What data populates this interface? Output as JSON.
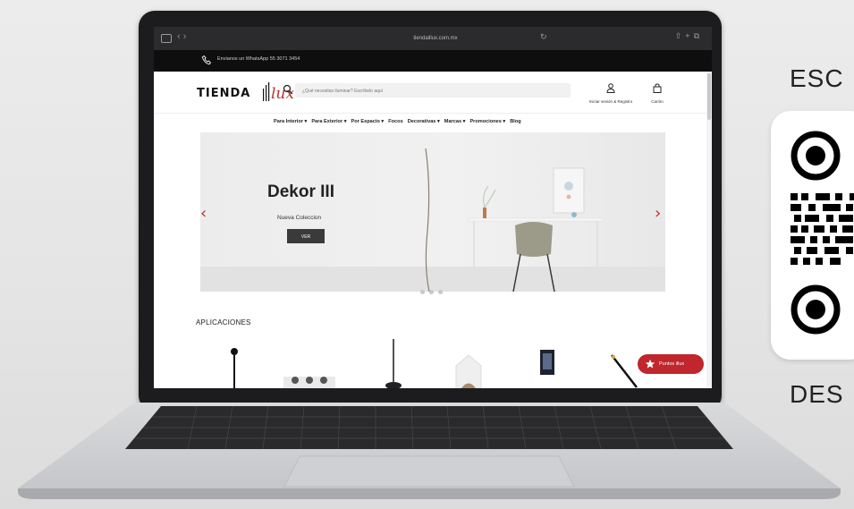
{
  "browser": {
    "url": "tiendaillux.com.mx",
    "nav_glyph": "‹ ›",
    "icons": [
      "sidebar-icon",
      "back-icon",
      "forward-icon",
      "reload-icon",
      "share-icon",
      "new-tab-icon",
      "tabs-icon"
    ]
  },
  "top_bar": {
    "whatsapp_text": "Envianos un WhatsApp 55 3071 3454"
  },
  "header": {
    "logo_text": "TIENDA",
    "logo_mark": "lux",
    "search_placeholder": "¿Qué necesitas iluminar? Escríbelo aquí",
    "account_label": "Iniciar sesión & Registro",
    "cart_label": "Carrito"
  },
  "nav": {
    "items": [
      "Para Interior ▾",
      "Para Exterior ▾",
      "Por Espacio ▾",
      "Focos",
      "Decorativas ▾",
      "Marcas ▾",
      "Promociones ▾",
      "Blog"
    ]
  },
  "hero": {
    "title": "Dekor III",
    "subtitle": "Nueva Coleccion",
    "button_label": "VER",
    "prev_glyph": "‹",
    "next_glyph": "›"
  },
  "applications": {
    "title": "APLICACIONES"
  },
  "floating": {
    "points_label": "Puntos illux"
  },
  "qr_panel": {
    "top_text": "ESC",
    "bottom_text": "DES"
  },
  "colors": {
    "brand_red": "#b8322a",
    "points_button": "#c0262b",
    "laptop_bezel": "#1c1c1e",
    "top_bar": "#0e0e0e"
  }
}
